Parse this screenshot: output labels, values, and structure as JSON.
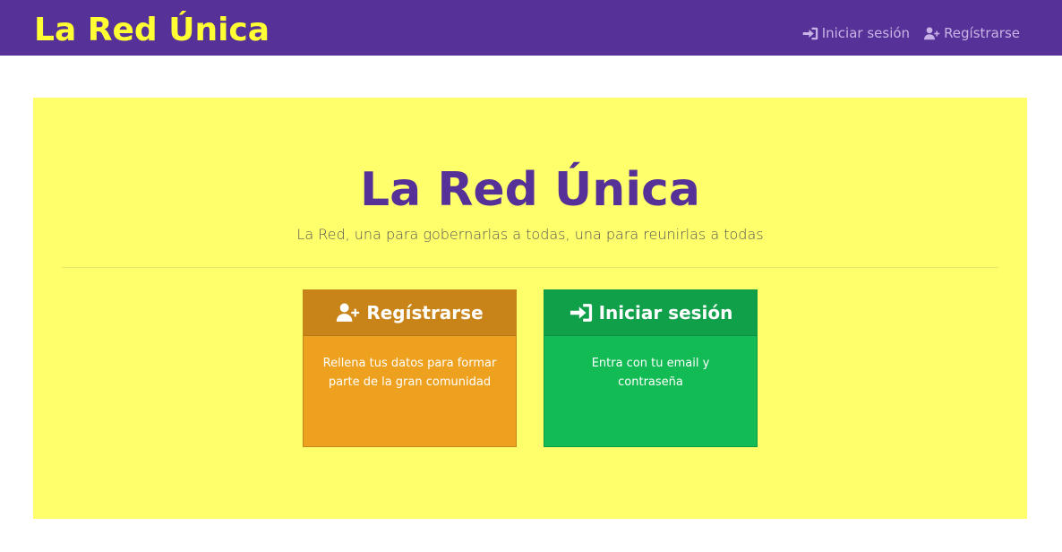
{
  "navbar": {
    "brand": "La Red Única",
    "links": [
      {
        "label": "Iniciar sesión",
        "icon": "sign-in-icon"
      },
      {
        "label": "Regístrarse",
        "icon": "user-plus-icon"
      }
    ]
  },
  "hero": {
    "title": "La Red Única",
    "lead": "La Red, una para gobernarlas a todas, una para reunirlas a todas"
  },
  "cards": [
    {
      "title": "Regístrarse",
      "icon": "user-plus-icon",
      "text": "Rellena tus datos para formar parte de la gran comunidad"
    },
    {
      "title": "Iniciar sesión",
      "icon": "sign-in-icon",
      "text": "Entra con tu email y contraseña"
    }
  ],
  "colors": {
    "navbar": "#563197",
    "brand": "#ffff33",
    "jumbotron": "#ffff6b",
    "register_card": "#eea11e",
    "login_card": "#13bb55"
  }
}
